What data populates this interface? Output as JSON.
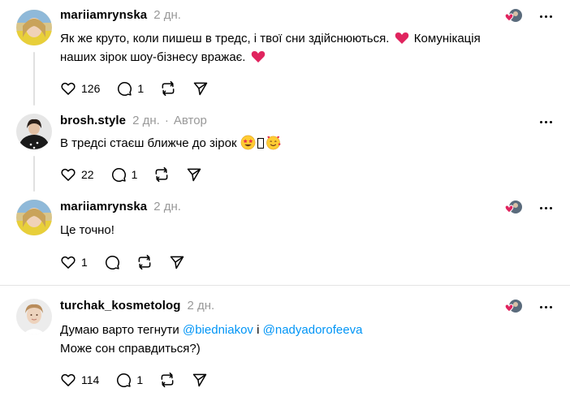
{
  "posts": [
    {
      "username": "mariiamrynska",
      "time": "2 дн.",
      "text_parts": [
        "Як же круто, коли пишеш в тредс, і твої сни здійснюються.",
        "Комунікація",
        "наших зірок шоу-бізнесу вражає."
      ],
      "likes": "126",
      "replies": "1",
      "liked_by_icon": "liked-by-avatars-icon"
    },
    {
      "username": "brosh.style",
      "time": "2 дн.",
      "separator": "·",
      "author_badge": "Автор",
      "text": "В тредсі стаєш ближче до зірок",
      "likes": "22",
      "replies": "1"
    },
    {
      "username": "mariiamrynska",
      "time": "2 дн.",
      "text": "Це точно!",
      "likes": "1",
      "liked_by_icon": "liked-by-avatars-icon"
    },
    {
      "username": "turchak_kosmetolog",
      "time": "2 дн.",
      "text_line1_prefix": "Думаю варто тегнути",
      "mention1": "@biedniakov",
      "conjunction": "і",
      "mention2": "@nadyadorofeeva",
      "text_line2": "Може сон справдиться?)",
      "likes": "114",
      "replies": "1",
      "liked_by_icon": "liked-by-avatars-icon"
    }
  ],
  "colors": {
    "text": "#000000",
    "muted": "#999999",
    "mention": "#0095f6",
    "heart": "#e0245e",
    "line": "#e0e0e0"
  }
}
